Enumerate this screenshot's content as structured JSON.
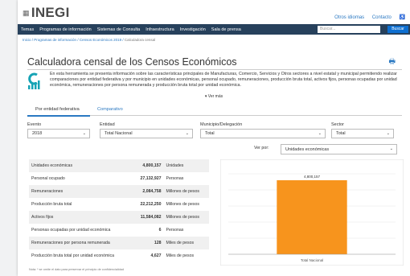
{
  "header": {
    "logo": "INEGI",
    "links": [
      "Otros idiomas",
      "Contacto"
    ]
  },
  "nav": {
    "items": [
      "Temas",
      "Programas de información",
      "Sistemas de Consulta",
      "Infraestructura",
      "Investigación",
      "Sala de prensa"
    ],
    "search_placeholder": "Buscar...",
    "search_button": "Buscar"
  },
  "breadcrumb": [
    "Inicio",
    "Programas de información",
    "Censos Económicos 2019",
    "Calculadora censal"
  ],
  "title": "Calculadora censal de los Censos Económicos",
  "description": "En esta herramienta se presenta información sobre las características principales de Manufacturas, Comercio, Servicios y Otros sectores a nivel estatal y municipal permitiendo realizar comparaciones por entidad federativa y por municipio en unidades económicas, personal ocupado, remuneraciones, producción bruta total, activos fijos, personas ocupadas por unidad económica, remuneraciones por persona remunerada y producción bruta total por unidad económica.",
  "ver_mas": "▾ Ver más",
  "tabs": [
    "Por entidad federativa",
    "Comparativo"
  ],
  "filters": [
    {
      "label": "Evento",
      "value": "2018"
    },
    {
      "label": "Entidad",
      "value": "Total Nacional"
    },
    {
      "label": "Municipio/Delegación",
      "value": "Total"
    },
    {
      "label": "Sector",
      "value": "Total"
    }
  ],
  "ver_por": {
    "label": "Ver por:",
    "value": "Unidades económicas"
  },
  "table": [
    {
      "name": "Unidades económicas",
      "value": "4,800,157",
      "unit": "Unidades"
    },
    {
      "name": "Personal ocupado",
      "value": "27,132,927",
      "unit": "Personas"
    },
    {
      "name": "Remuneraciones",
      "value": "2,084,758",
      "unit": "Millones de pesos"
    },
    {
      "name": "Producción bruta total",
      "value": "22,212,250",
      "unit": "Millones de pesos"
    },
    {
      "name": "Activos fijos",
      "value": "11,584,082",
      "unit": "Millones de pesos"
    },
    {
      "name": "Personas ocupadas por unidad económica",
      "value": "6",
      "unit": "Personas"
    },
    {
      "name": "Remuneraciones por persona remunerada",
      "value": "128",
      "unit": "Miles de pesos"
    },
    {
      "name": "Producción bruta total por unidad económica",
      "value": "4,627",
      "unit": "Miles de pesos"
    }
  ],
  "chart_data": {
    "type": "bar",
    "categories": [
      "Total Nacional"
    ],
    "values": [
      4800157
    ],
    "data_label": "4,800,157",
    "color": "#f7941d",
    "grid": true
  },
  "note": "Nota: * se omite el dato para preservar el principio de confidencialidad"
}
